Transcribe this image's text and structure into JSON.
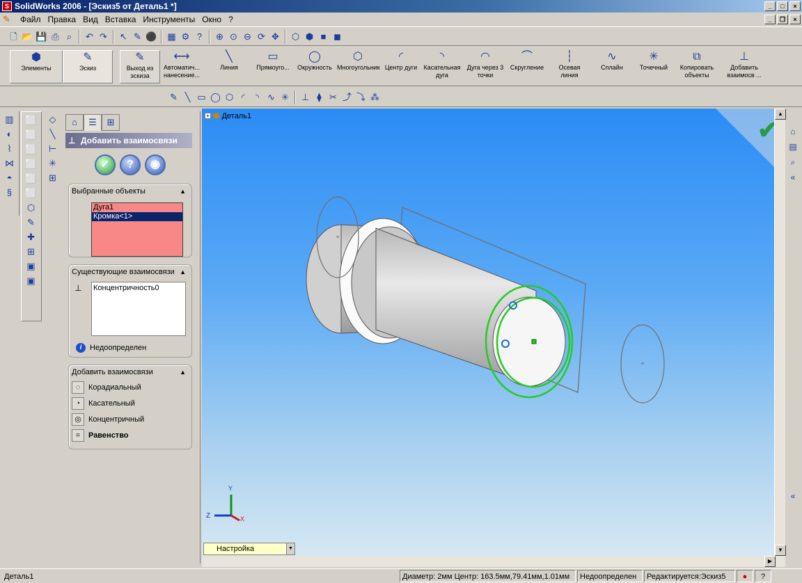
{
  "window": {
    "title": "SolidWorks 2006 - [Эскиз5 от Деталь1 *]"
  },
  "menu": {
    "items": [
      "Файл",
      "Правка",
      "Вид",
      "Вставка",
      "Инструменты",
      "Окно",
      "?"
    ]
  },
  "command_manager": {
    "elements": "Элементы",
    "sketch": "Эскиз",
    "items": [
      {
        "label": "Выход из эскиза",
        "icon": "exit-sketch-icon"
      },
      {
        "label": "Автоматич... нанесение...",
        "icon": "smart-dimension-icon"
      },
      {
        "label": "Линия",
        "icon": "line-icon"
      },
      {
        "label": "Прямоуго...",
        "icon": "rectangle-icon"
      },
      {
        "label": "Окружность",
        "icon": "circle-icon"
      },
      {
        "label": "Многоугольник",
        "icon": "polygon-icon"
      },
      {
        "label": "Центр дуги",
        "icon": "center-arc-icon"
      },
      {
        "label": "Касательная дуга",
        "icon": "tangent-arc-icon"
      },
      {
        "label": "Дуга через 3 точки",
        "icon": "three-point-arc-icon"
      },
      {
        "label": "Скругление",
        "icon": "fillet-icon"
      },
      {
        "label": "Осевая линия",
        "icon": "centerline-icon"
      },
      {
        "label": "Сплайн",
        "icon": "spline-icon"
      },
      {
        "label": "Точечный",
        "icon": "point-icon"
      },
      {
        "label": "Копировать объекты",
        "icon": "copy-entities-icon"
      },
      {
        "label": "Добавить взаимосв ...",
        "icon": "add-relation-icon"
      }
    ]
  },
  "property_manager": {
    "title": "Добавить взаимосвязи",
    "selected_group": {
      "title": "Выбранные объекты",
      "items": [
        "Дуга1",
        "Кромка<1>"
      ]
    },
    "existing_group": {
      "title": "Существующие взаимосвязи",
      "items": [
        "Концентричность0"
      ],
      "status": "Недоопределен"
    },
    "add_group": {
      "title": "Добавить взаимосвязи",
      "items": [
        "Корадиальный",
        "Касательный",
        "Концентричный",
        "Равенство"
      ]
    }
  },
  "viewport": {
    "tree_label": "Деталь1",
    "triad": {
      "x": "X",
      "y": "Y",
      "z": "Z"
    }
  },
  "config_tab": "Настройка",
  "statusbar": {
    "doc": "Деталь1",
    "measure": "Диаметр: 2мм  Центр: 163.5мм,79.41мм,1.01мм",
    "state": "Недоопределен",
    "editing": "Редактируется:Эскиз5"
  },
  "colors": {
    "sketch_green": "#22cc22",
    "viewport_top": "#2b8cf5",
    "selected_list": "#f88888"
  }
}
